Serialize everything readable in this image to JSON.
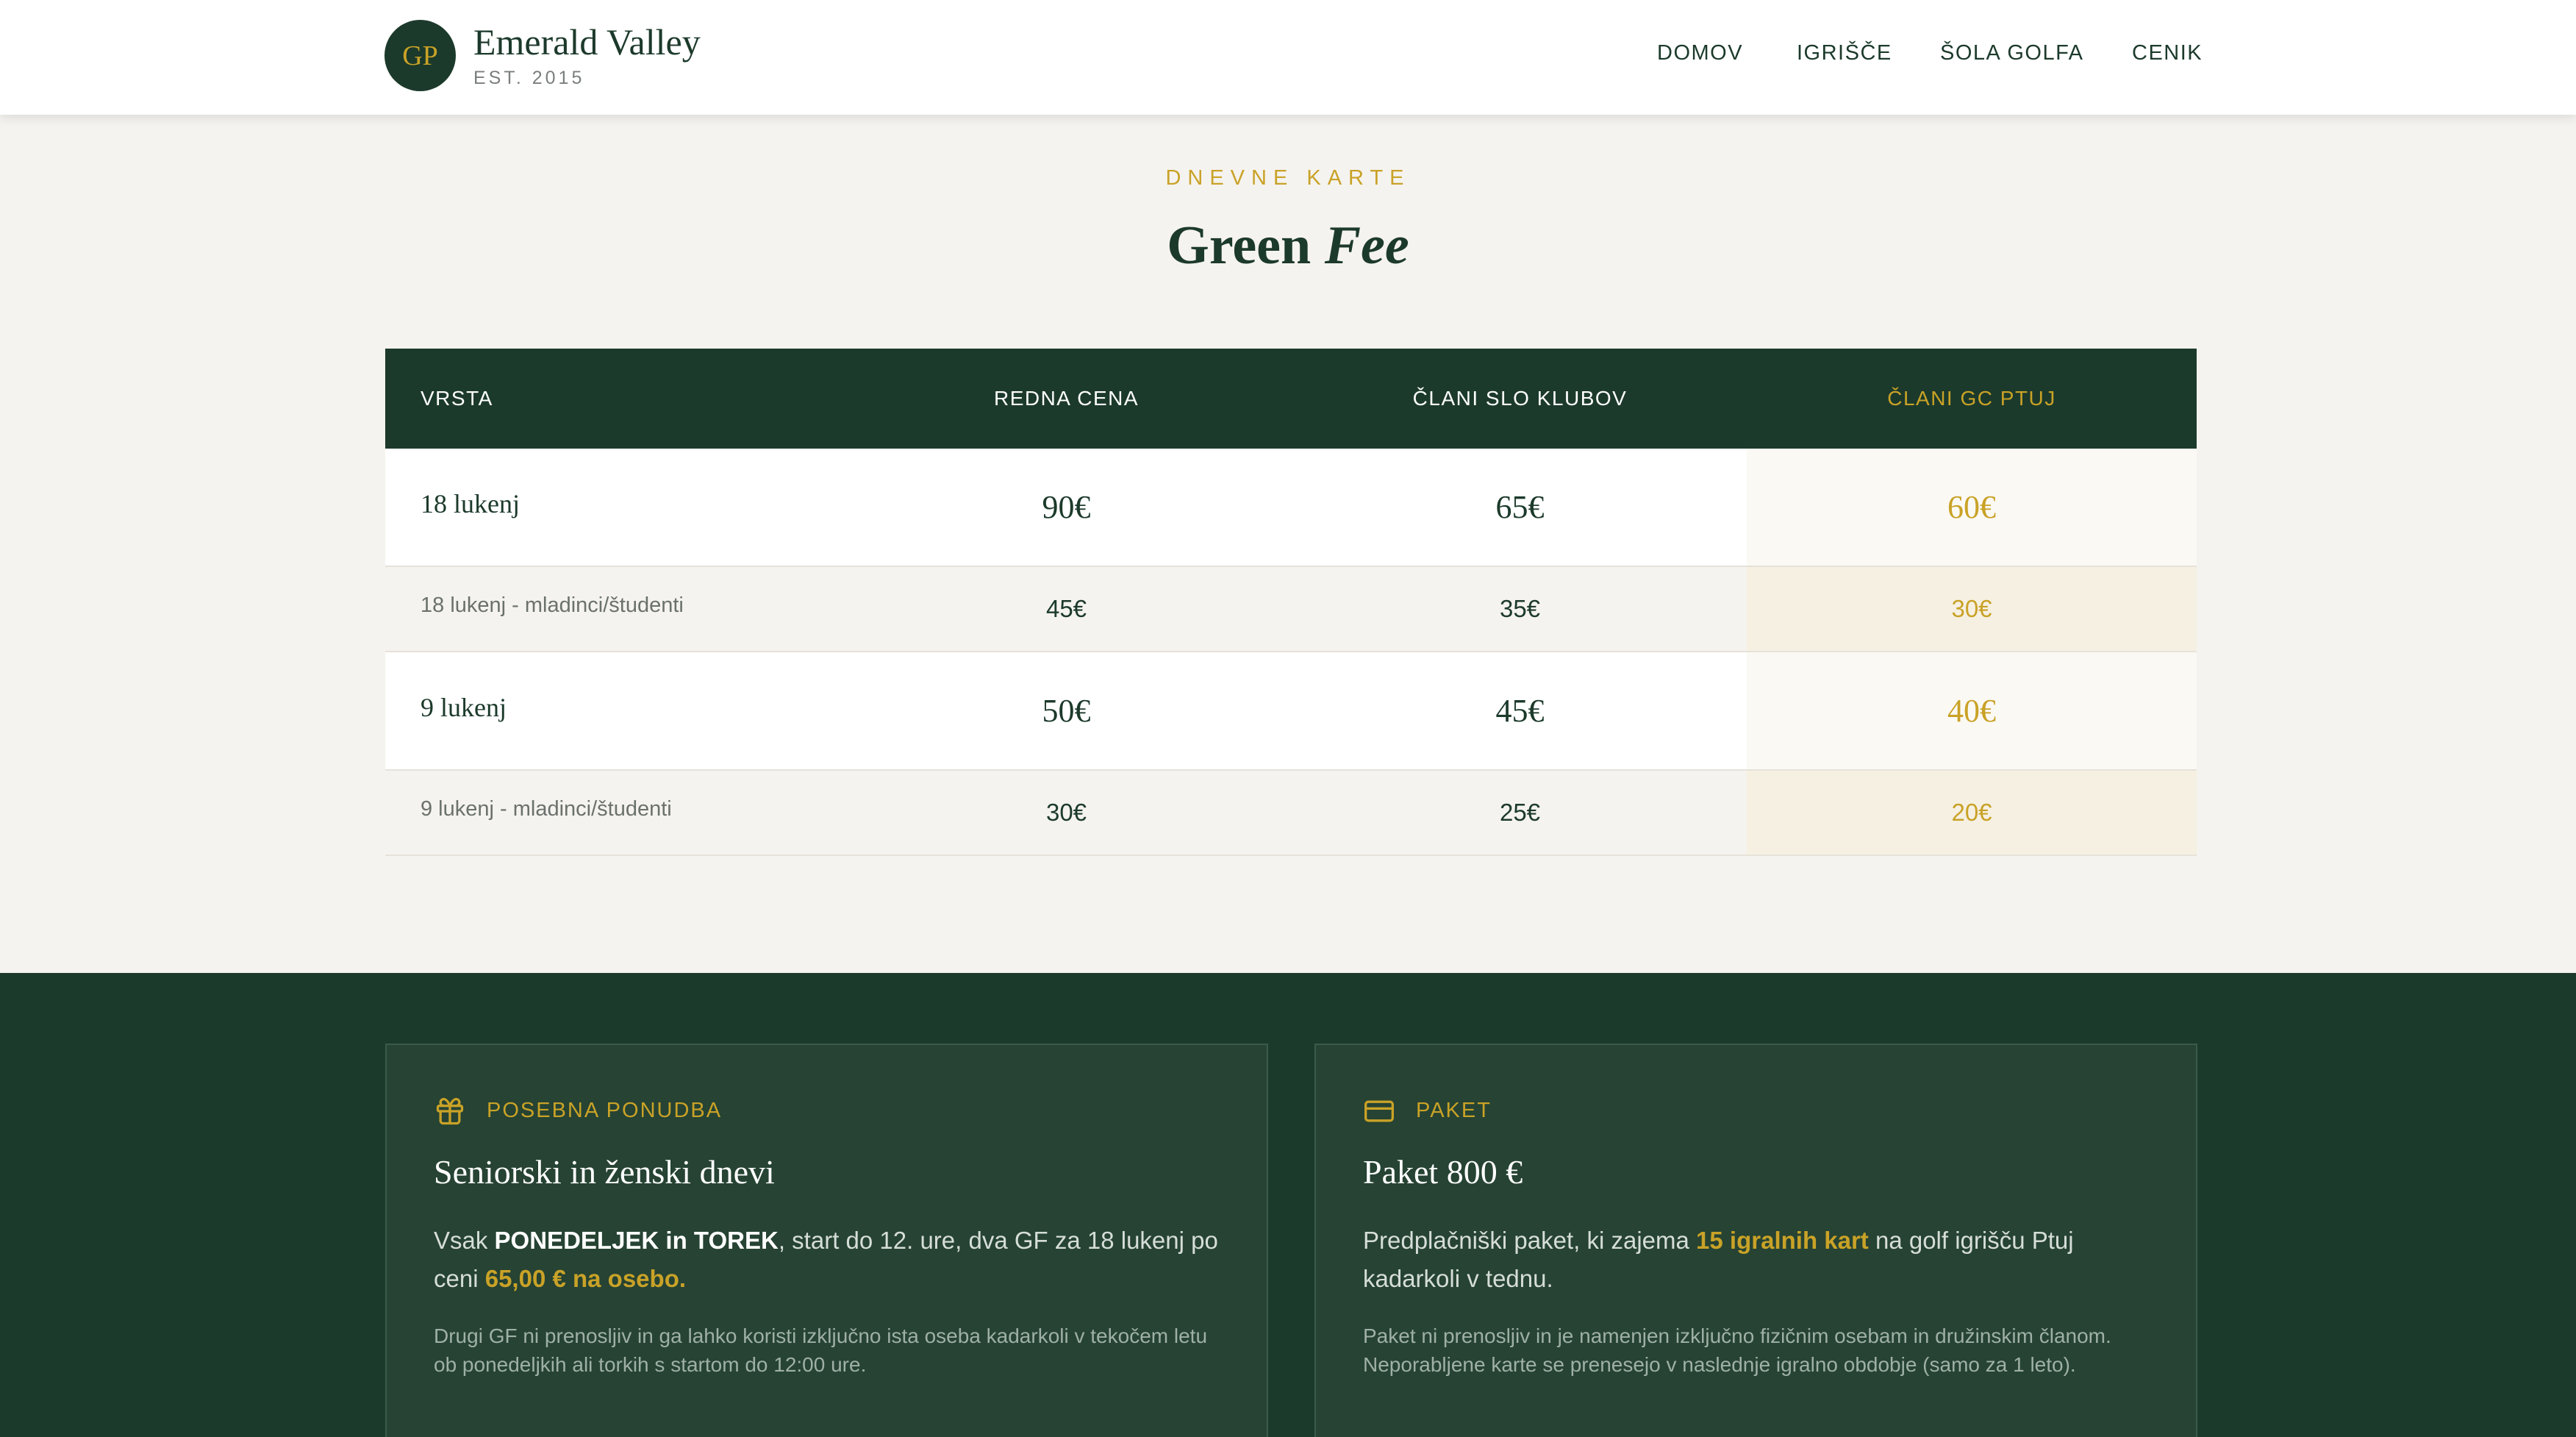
{
  "header": {
    "logo_initials": "GP",
    "brand_name": "Emerald Valley",
    "brand_est": "EST. 2015",
    "nav": [
      "DOMOV",
      "IGRIŠČE",
      "ŠOLA GOLFA",
      "CENIK"
    ]
  },
  "section": {
    "eyebrow": "DNEVNE KARTE",
    "title_plain": "Green",
    "title_italic": "Fee"
  },
  "table": {
    "headers": [
      "VRSTA",
      "REDNA CENA",
      "ČLANI SLO KLUBOV",
      "ČLANI GC PTUJ"
    ],
    "rows": [
      {
        "label": "18 lukenj",
        "regular": "90€",
        "slo": "65€",
        "ptuj": "60€"
      },
      {
        "label": "18 lukenj - mladinci/študenti",
        "regular": "45€",
        "slo": "35€",
        "ptuj": "30€"
      },
      {
        "label": "9 lukenj",
        "regular": "50€",
        "slo": "45€",
        "ptuj": "40€"
      },
      {
        "label": "9 lukenj - mladinci/študenti",
        "regular": "30€",
        "slo": "25€",
        "ptuj": "20€"
      }
    ]
  },
  "offer": {
    "eyebrow": "POSEBNA PONUDBA",
    "icon": "gift-icon",
    "title": "Seniorski in ženski dnevi",
    "body_1": "Vsak ",
    "body_bold": "PONEDELJEK in TOREK",
    "body_2": ", start do 12. ure, dva GF za 18 lukenj po ceni ",
    "body_highlight": "65,00 € na osebo",
    "body_3": ".",
    "note": "Drugi GF ni prenosljiv in ga lahko koristi izključno ista oseba kadarkoli v tekočem letu ob ponedeljkih ali torkih s startom do 12:00 ure."
  },
  "package": {
    "eyebrow": "PAKET",
    "icon": "card-icon",
    "title": "Paket 800 €",
    "body_1": "Predplačniški paket, ki zajema ",
    "body_highlight": "15 igralnih kart",
    "body_2": " na golf igrišču Ptuj kadarkoli v tednu.",
    "note": "Paket ni prenosljiv in je namenjen izključno fizičnim osebam in družinskim članom. Neporabljene karte se prenesejo v naslednje igralno obdobje (samo za 1 leto)."
  },
  "colors": {
    "forest": "#1c3a2b",
    "gold": "#c9a227",
    "cream": "#f5f3ef",
    "card": "#264333"
  }
}
